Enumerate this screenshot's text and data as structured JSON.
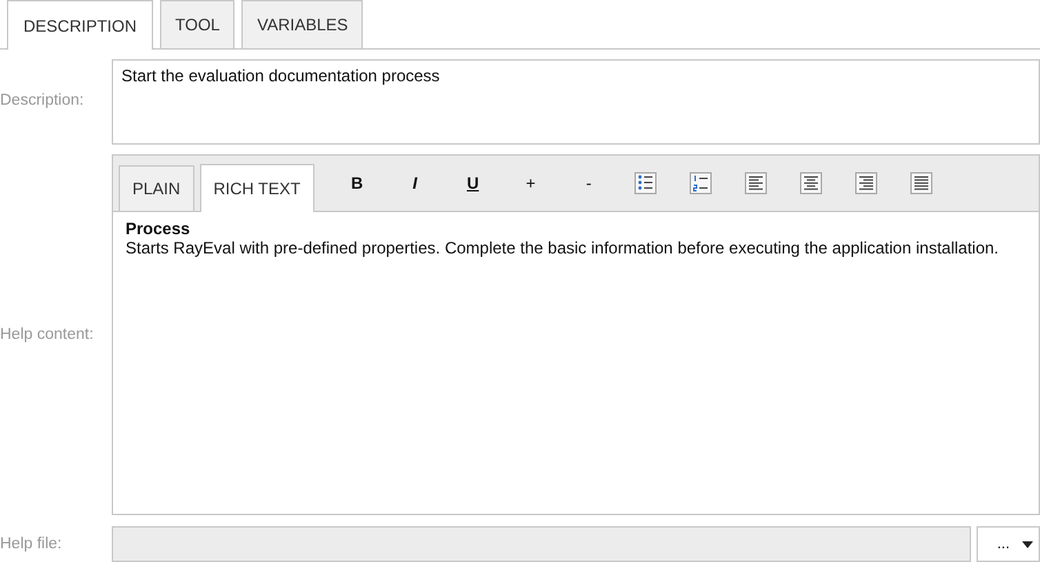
{
  "tabs": [
    {
      "label": "DESCRIPTION",
      "selected": true
    },
    {
      "label": "TOOL",
      "selected": false
    },
    {
      "label": "VARIABLES",
      "selected": false
    }
  ],
  "description": {
    "label": "Description:",
    "value": "Start the evaluation documentation process"
  },
  "help_content": {
    "label": "Help content:",
    "editor_tabs": [
      {
        "label": "PLAIN",
        "selected": false
      },
      {
        "label": "RICH TEXT",
        "selected": true
      }
    ],
    "toolbar": [
      {
        "kind": "bold",
        "label": "B"
      },
      {
        "kind": "italic",
        "label": "I"
      },
      {
        "kind": "underline",
        "label": "U"
      },
      {
        "kind": "text",
        "label": "+"
      },
      {
        "kind": "text",
        "label": "-"
      },
      {
        "kind": "bulleted-list"
      },
      {
        "kind": "numbered-list"
      },
      {
        "kind": "align-left"
      },
      {
        "kind": "align-center"
      },
      {
        "kind": "align-right"
      },
      {
        "kind": "justify"
      }
    ],
    "heading": "Process",
    "body": "Starts RayEval with pre-defined properties. Complete the basic information before executing the application installation."
  },
  "help_file": {
    "label": "Help file:",
    "button": "..."
  }
}
